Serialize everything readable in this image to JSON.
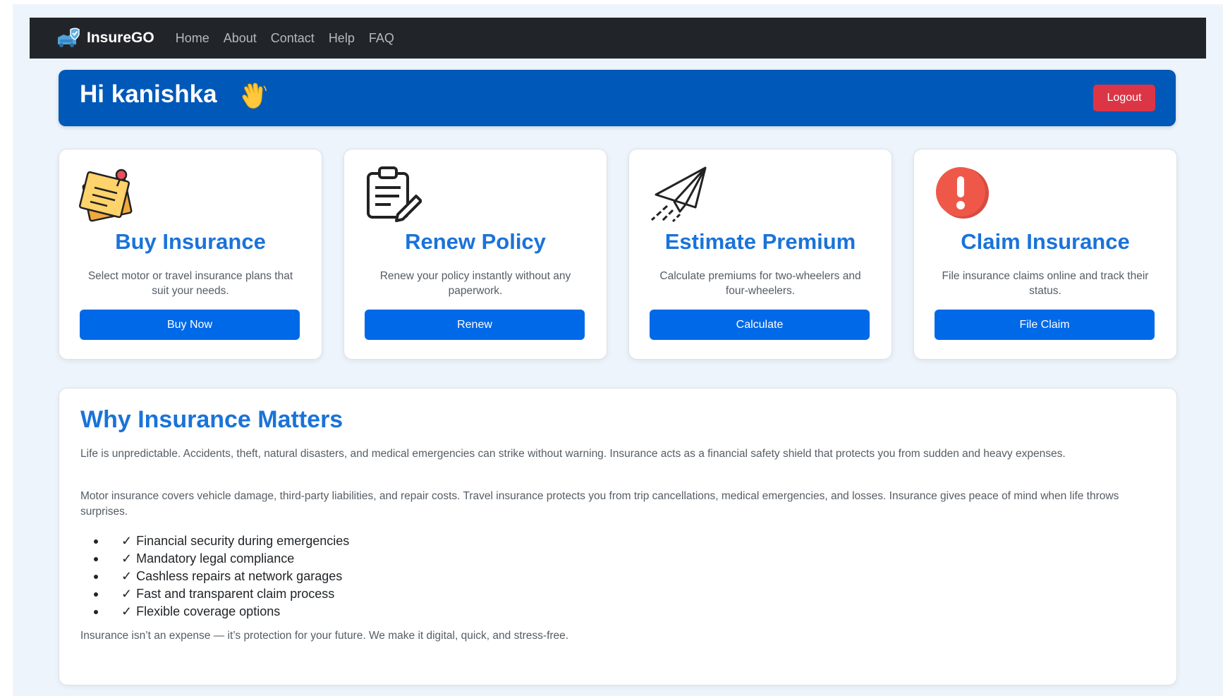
{
  "navbar": {
    "brand": "InsureGO",
    "links": [
      "Home",
      "About",
      "Contact",
      "Help",
      "FAQ"
    ]
  },
  "welcome": {
    "greeting": "Hi kanishka",
    "logout_label": "Logout"
  },
  "cards": [
    {
      "icon": "notepad-icon",
      "title": "Buy Insurance",
      "description": "Select motor or travel insurance plans that suit your needs.",
      "button": "Buy Now"
    },
    {
      "icon": "clipboard-pencil-icon",
      "title": "Renew Policy",
      "description": "Renew your policy instantly without any paperwork.",
      "button": "Renew"
    },
    {
      "icon": "paper-plane-icon",
      "title": "Estimate Premium",
      "description": "Calculate premiums for two-wheelers and four-wheelers.",
      "button": "Calculate"
    },
    {
      "icon": "exclamation-icon",
      "title": "Claim Insurance",
      "description": "File insurance claims online and track their status.",
      "button": "File Claim"
    }
  ],
  "why": {
    "title": "Why Insurance Matters",
    "paragraph1": "Life is unpredictable. Accidents, theft, natural disasters, and medical emergencies can strike without warning. Insurance acts as a financial safety shield that protects you from sudden and heavy expenses.",
    "paragraph2": "Motor insurance covers vehicle damage, third-party liabilities, and repair costs. Travel insurance protects you from trip cancellations, medical emergencies, and losses. Insurance gives peace of mind when life throws surprises.",
    "check_mark": "✓",
    "benefits": [
      "Financial security during emergencies",
      "Mandatory legal compliance",
      "Cashless repairs at network garages",
      "Fast and transparent claim process",
      "Flexible coverage options"
    ],
    "closing": "Insurance isn’t an expense — it’s protection for your future. We make it digital, quick, and stress-free."
  },
  "colors": {
    "navbar_bg": "#212529",
    "welcome_bg": "#0058b8",
    "accent_blue": "#1a73d9",
    "button_blue": "#0069e8",
    "logout_red": "#dc3545",
    "page_bg": "#eef4fc"
  }
}
